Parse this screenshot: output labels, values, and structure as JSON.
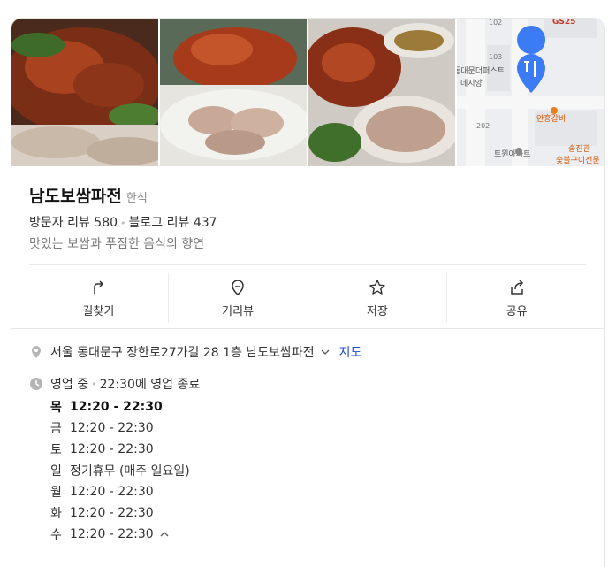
{
  "place": {
    "name": "남도보쌈파전",
    "category": "한식",
    "visitor_reviews": "방문자 리뷰 580",
    "blog_reviews": "블로그 리뷰 437",
    "description": "맛있는 보쌈과 푸짐한 음식의 향연"
  },
  "map_labels": [
    "102",
    "GS25",
    "103",
    "동대문더퍼스트",
    "데시앙",
    "202",
    "안흥갈비",
    "트윈아파트",
    "송진관",
    "숯불구이전문"
  ],
  "actions": [
    {
      "label": "길찾기",
      "icon": "directions-icon"
    },
    {
      "label": "거리뷰",
      "icon": "street-view-icon"
    },
    {
      "label": "저장",
      "icon": "star-icon"
    },
    {
      "label": "공유",
      "icon": "share-icon"
    }
  ],
  "address": {
    "text": "서울 동대문구 장한로27가길 28 1층 남도보쌈파전",
    "map_link": "지도"
  },
  "business": {
    "status": "영업 중",
    "close_info": "22:30에 영업 종료"
  },
  "hours": [
    {
      "day": "목",
      "time": "12:20 - 22:30",
      "today": true
    },
    {
      "day": "금",
      "time": "12:20 - 22:30"
    },
    {
      "day": "토",
      "time": "12:20 - 22:30"
    },
    {
      "day": "일",
      "time": "정기휴무 (매주 일요일)"
    },
    {
      "day": "월",
      "time": "12:20 - 22:30"
    },
    {
      "day": "화",
      "time": "12:20 - 22:30"
    },
    {
      "day": "수",
      "time": "12:20 - 22:30"
    }
  ],
  "colors": {
    "link": "#1a4fd1",
    "map_pin": "#3b7cf5",
    "text_muted": "#7a7a7a"
  }
}
